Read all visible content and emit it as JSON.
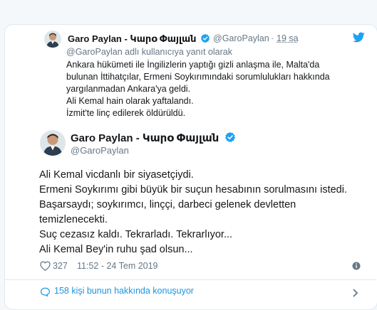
{
  "quoted_tweet": {
    "author_name": "Garo Paylan - Կարօ Փայլան",
    "handle": "@GaroPaylan",
    "separator": "·",
    "time": "19 sa",
    "reply_context": "@GaroPaylan adlı kullanıcıya yanıt olarak",
    "lines": [
      "Ankara hükümeti ile İngilizlerin yaptığı gizli anlaşma ile, Malta'da",
      "bulunan İttihatçılar, Ermeni Soykırımındaki sorumlulukları hakkında",
      "yargılanmadan Ankara'ya geldi.",
      "Ali Kemal hain olarak yaftalandı.",
      "İzmit'te linç edilerek öldürüldü."
    ]
  },
  "main_tweet": {
    "author_name": "Garo Paylan - Կարօ Փայլան",
    "handle": "@GaroPaylan",
    "lines": [
      "Ali Kemal vicdanlı bir siyasetçiydi.",
      "Ermeni Soykırımı gibi büyük bir suçun hesabının sorulmasını istedi.",
      "Başarsaydı; soykırımcı, linççi, darbeci gelenek devletten",
      "temizlenecekti.",
      "Suç cezasız kaldı. Tekrarladı. Tekrarlıyor...",
      "Ali Kemal Bey'in ruhu şad olsun..."
    ],
    "like_count": "327",
    "timestamp": "11:52 - 24 Tem 2019"
  },
  "conversation": {
    "text": "158 kişi bunun hakkında konuşuyor"
  },
  "colors": {
    "accent": "#1da1f2",
    "link": "#1b95e0",
    "muted": "#657786",
    "text": "#14171a"
  },
  "icons": {
    "twitter": "twitter-bird-icon",
    "verified": "verified-badge-icon",
    "heart": "heart-icon",
    "info": "info-icon",
    "chat": "chat-bubble-icon",
    "chevron": "chevron-right-icon"
  }
}
